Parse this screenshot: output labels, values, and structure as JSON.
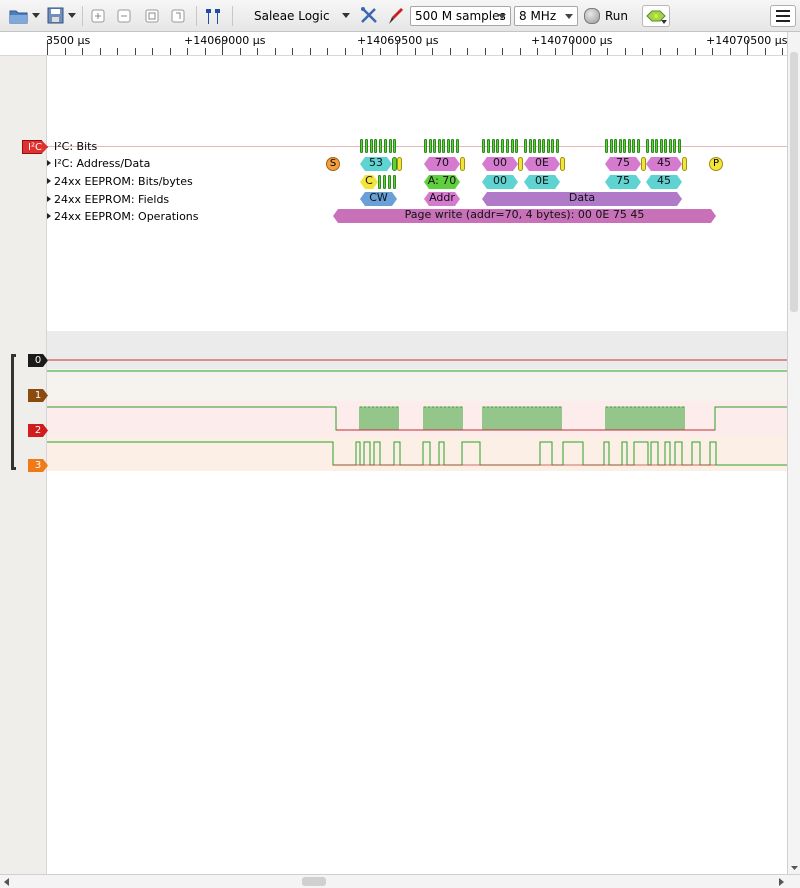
{
  "toolbar": {
    "device_label": "Saleae Logic",
    "samples": "500 M samples",
    "rate": "8 MHz",
    "run_label": "Run"
  },
  "ruler": {
    "labels": [
      "3500 µs",
      "+14069000 µs",
      "+14069500 µs",
      "+14070000 µs",
      "+14070500 µs"
    ]
  },
  "analyzer": {
    "tag": "I²C",
    "rows": [
      {
        "label": "I²C: Bits"
      },
      {
        "label": "I²C: Address/Data"
      },
      {
        "label": "24xx EEPROM: Bits/bytes"
      },
      {
        "label": "24xx EEPROM: Fields"
      },
      {
        "label": "24xx EEPROM: Operations"
      }
    ],
    "start_marker": "S",
    "stop_marker": "P",
    "address_data": [
      "53",
      "70",
      "00",
      "0E",
      "75",
      "45"
    ],
    "bits_bytes": {
      "control": "C",
      "address": "A: 70",
      "bytes": [
        "00",
        "0E",
        "75",
        "45"
      ]
    },
    "fields": [
      "CW",
      "Addr",
      "Data"
    ],
    "operation": "Page write (addr=70, 4 bytes): 00 0E 75 45"
  },
  "channels": [
    {
      "id": "0",
      "color": "#1a1a1a"
    },
    {
      "id": "1",
      "color": "#8b4a10"
    },
    {
      "id": "2",
      "color": "#d01c1c"
    },
    {
      "id": "3",
      "color": "#f07a18"
    }
  ],
  "colors": {
    "analyzer_band": "#fde8e8",
    "data_cyan": "#5fd2d2",
    "data_magenta": "#d67ad0",
    "field_blue": "#6aa0d8",
    "field_purple": "#b07ac8",
    "bits_green": "#5fcf3f",
    "marker_yellow": "#f3e43a",
    "marker_orange": "#f0a040"
  }
}
